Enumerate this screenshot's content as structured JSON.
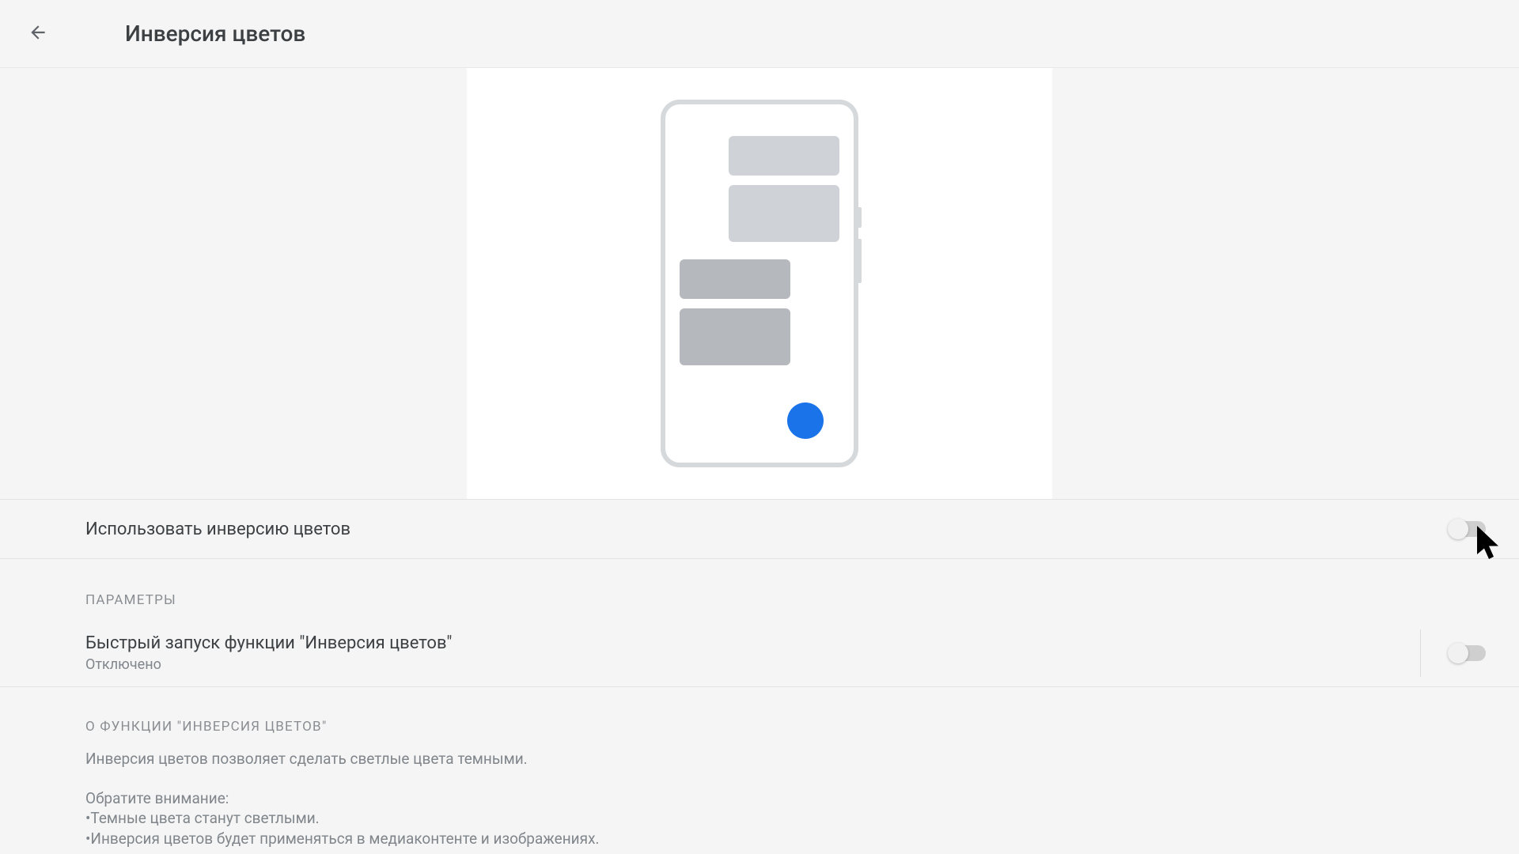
{
  "header": {
    "title": "Инверсия цветов"
  },
  "main_toggle": {
    "label": "Использовать инверсию цветов",
    "state": false
  },
  "sections": {
    "params": {
      "header": "ПАРАМЕТРЫ",
      "shortcut": {
        "title": "Быстрый запуск функции \"Инверсия цветов\"",
        "subtitle": "Отключено",
        "state": false
      }
    },
    "about": {
      "header": "О ФУНКЦИИ \"ИНВЕРСИЯ ЦВЕТОВ\"",
      "p1": "Инверсия цветов позволяет сделать светлые цвета темными.",
      "p2_intro": "Обратите внимание:",
      "p2_bullet1": "•Темные цвета станут светлыми.",
      "p2_bullet2": "•Инверсия цветов будет применяться в медиаконтенте и изображениях."
    }
  }
}
